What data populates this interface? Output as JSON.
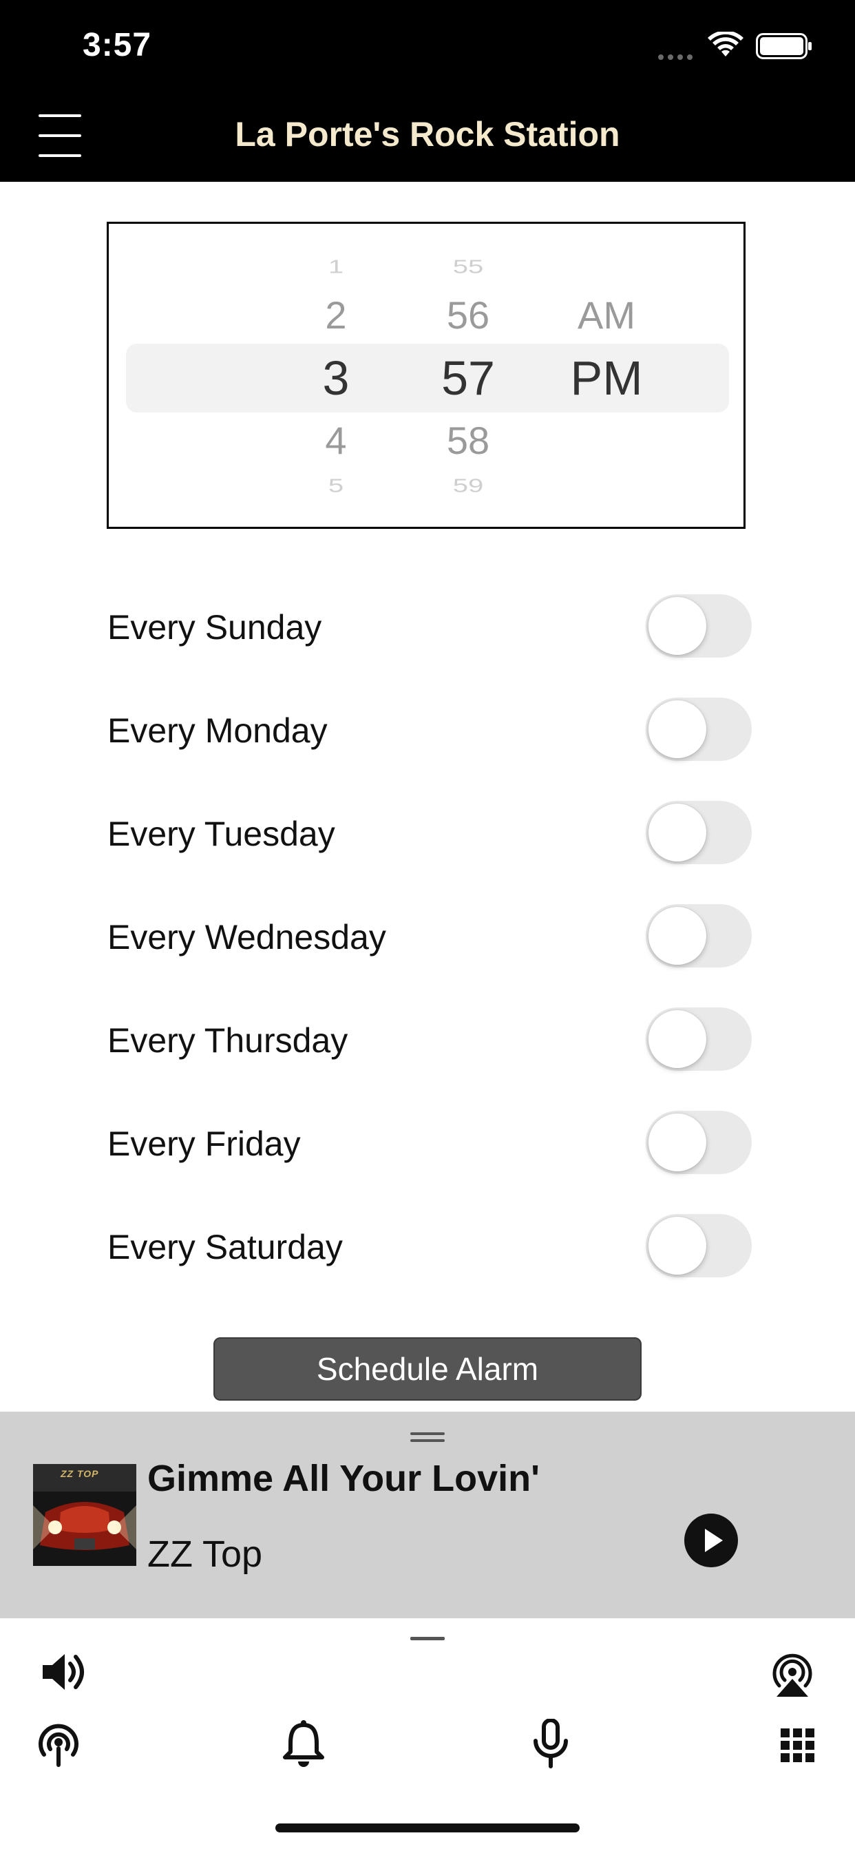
{
  "status_bar": {
    "time": "3:57"
  },
  "nav": {
    "title": "La Porte's Rock Station"
  },
  "time_picker": {
    "hours": [
      "1",
      "2",
      "3",
      "4",
      "5"
    ],
    "minutes": [
      "55",
      "56",
      "57",
      "58",
      "59"
    ],
    "period": [
      "AM",
      "PM"
    ],
    "selected": {
      "hour": "3",
      "minute": "57",
      "period": "PM"
    }
  },
  "days": [
    {
      "label": "Every Sunday",
      "enabled": false
    },
    {
      "label": "Every Monday",
      "enabled": false
    },
    {
      "label": "Every Tuesday",
      "enabled": false
    },
    {
      "label": "Every Wednesday",
      "enabled": false
    },
    {
      "label": "Every Thursday",
      "enabled": false
    },
    {
      "label": "Every Friday",
      "enabled": false
    },
    {
      "label": "Every Saturday",
      "enabled": false
    }
  ],
  "schedule_button": {
    "label": "Schedule Alarm"
  },
  "now_playing": {
    "title": "Gimme All Your Lovin'",
    "artist": "ZZ Top",
    "album_art_text": "ZZ TOP"
  },
  "bottom_icons": {
    "volume": "volume-icon",
    "airplay": "airplay-icon",
    "stream": "podcast-icon",
    "alarm": "bell-icon",
    "mic": "microphone-icon",
    "apps": "grid-icon"
  },
  "colors": {
    "nav_bg": "#000000",
    "title": "#f4e9cc",
    "now_playing_bg": "#d0d0d0",
    "button_bg": "#555555",
    "toggle_off": "#e9e9ea"
  }
}
